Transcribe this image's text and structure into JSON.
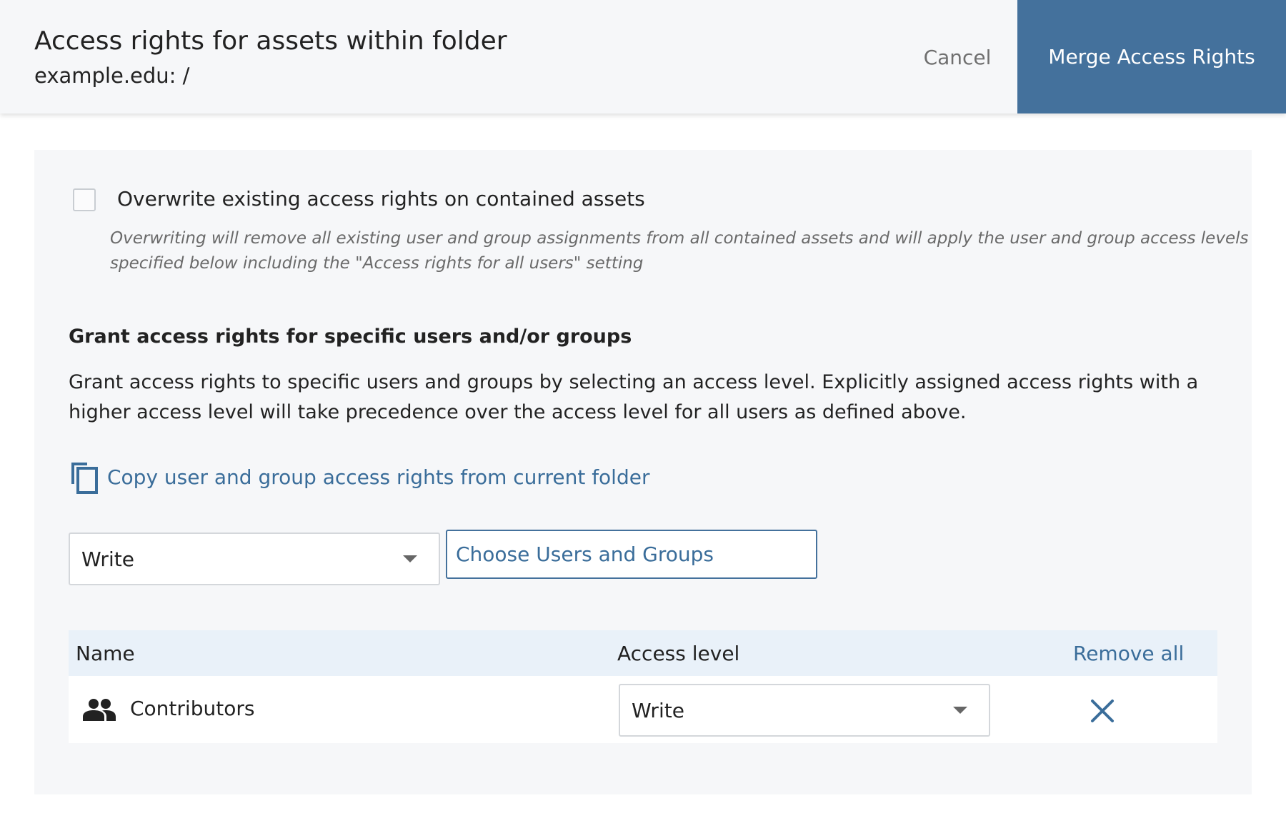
{
  "header": {
    "title": "Access rights for assets within folder",
    "subtitle": "example.edu: /",
    "cancel_label": "Cancel",
    "merge_label": "Merge Access Rights"
  },
  "overwrite": {
    "checked": false,
    "label": "Overwrite existing access rights on contained assets",
    "note": "Overwriting will remove all existing user and group assignments from all contained assets and will apply the user and group access levels specified below including the \"Access rights for all users\" setting"
  },
  "grant": {
    "heading": "Grant access rights for specific users and/or groups",
    "description": "Grant access rights to specific users and groups by selecting an access level. Explicitly assigned access rights with a higher access level will take precedence over the access level for all users as defined above.",
    "copy_link_label": "Copy user and group access rights from current folder",
    "access_select_value": "Write",
    "choose_button_label": "Choose Users and Groups"
  },
  "table": {
    "headers": {
      "name": "Name",
      "access_level": "Access level",
      "remove_all": "Remove all"
    },
    "rows": [
      {
        "icon": "group-icon",
        "name": "Contributors",
        "access_level": "Write"
      }
    ]
  },
  "colors": {
    "accent": "#44719c",
    "link": "#3a6d9a",
    "panel_bg": "#f6f7f9",
    "table_header_bg": "#e9f1f9"
  }
}
